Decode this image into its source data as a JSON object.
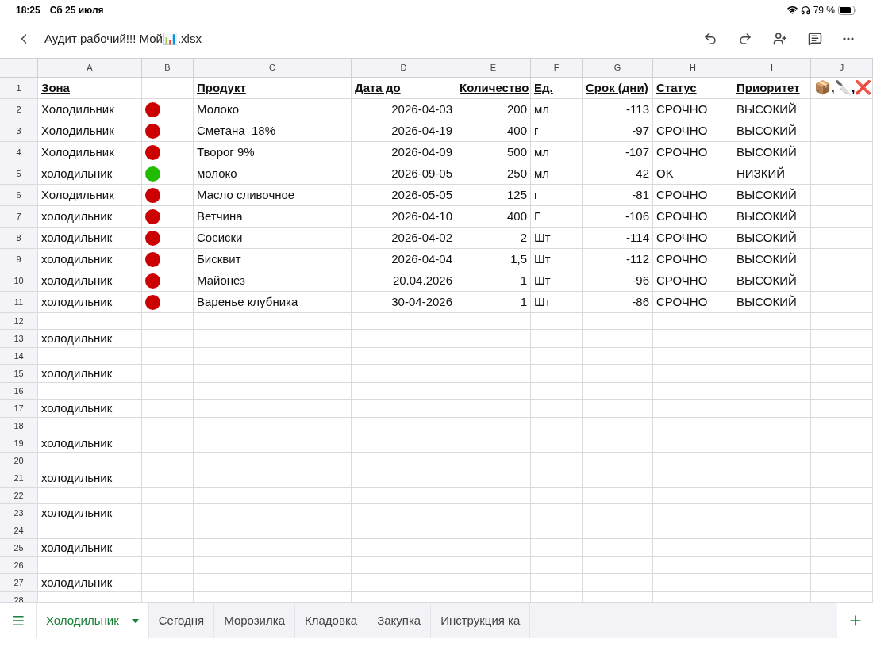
{
  "status_bar": {
    "time": "18:25",
    "date": "Сб 25 июля",
    "battery": "79 %"
  },
  "toolbar": {
    "title": "Аудит рабочий!!! Мой📊.xlsx"
  },
  "columns": [
    "A",
    "B",
    "C",
    "D",
    "E",
    "F",
    "G",
    "H",
    "I",
    "J"
  ],
  "rows": [
    {
      "number": "1",
      "kind": "header",
      "zone": "Зона",
      "product": "Продукт",
      "date": "Дата до",
      "qty": "Количество",
      "unit": "Ед.",
      "days": "Срок (дни)",
      "status": "Статус",
      "priority": "Приоритет",
      "extra": "📦,🔪,❌"
    },
    {
      "number": "2",
      "kind": "item",
      "zone": "Холодильник",
      "color": "#cc0000",
      "product": "Молоко",
      "date": "2026-04-03",
      "qty": "200",
      "unit": "мл",
      "days": "-113",
      "status": "СРОЧНО",
      "priority": "ВЫСОКИЙ"
    },
    {
      "number": "3",
      "kind": "item",
      "zone": "Холодильник",
      "color": "#cc0000",
      "product": "Сметана  18%",
      "date": "2026-04-19",
      "qty": "400",
      "unit": "г",
      "days": "-97",
      "status": "СРОЧНО",
      "priority": "ВЫСОКИЙ"
    },
    {
      "number": "4",
      "kind": "item",
      "zone": "Холодильник",
      "color": "#cc0000",
      "product": "Творог 9%",
      "date": "2026-04-09",
      "qty": "500",
      "unit": "мл",
      "days": "-107",
      "status": "СРОЧНО",
      "priority": "ВЫСОКИЙ"
    },
    {
      "number": "5",
      "kind": "item",
      "zone": "холодильник",
      "color": "#22bb00",
      "product": "молоко",
      "date": "2026-09-05",
      "qty": "250",
      "unit": "мл",
      "days": "42",
      "status": "OK",
      "priority": "НИЗКИЙ"
    },
    {
      "number": "6",
      "kind": "item",
      "zone": "Холодильник",
      "color": "#cc0000",
      "product": "Масло сливочное",
      "date": "2026-05-05",
      "qty": "125",
      "unit": "г",
      "days": "-81",
      "status": "СРОЧНО",
      "priority": "ВЫСОКИЙ"
    },
    {
      "number": "7",
      "kind": "item",
      "zone": "холодильник",
      "color": "#cc0000",
      "product": "Ветчина",
      "date": "2026-04-10",
      "qty": "400",
      "unit": "Г",
      "days": "-106",
      "status": "СРОЧНО",
      "priority": "ВЫСОКИЙ"
    },
    {
      "number": "8",
      "kind": "item",
      "zone": "холодильник",
      "color": "#cc0000",
      "product": "Сосиски",
      "date": "2026-04-02",
      "qty": "2",
      "unit": "Шт",
      "days": "-114",
      "status": "СРОЧНО",
      "priority": "ВЫСОКИЙ"
    },
    {
      "number": "9",
      "kind": "item",
      "zone": "холодильник",
      "color": "#cc0000",
      "product": "Бисквит",
      "date": "2026-04-04",
      "qty": "1,5",
      "unit": "Шт",
      "days": "-112",
      "status": "СРОЧНО",
      "priority": "ВЫСОКИЙ"
    },
    {
      "number": "10",
      "kind": "item",
      "zone": "холодильник",
      "color": "#cc0000",
      "product": "Майонез",
      "date": "20.04.2026",
      "qty": "1",
      "unit": "Шт",
      "days": "-96",
      "status": "СРОЧНО",
      "priority": "ВЫСОКИЙ"
    },
    {
      "number": "11",
      "kind": "item",
      "zone": "холодильник",
      "color": "#cc0000",
      "product": "Варенье клубника",
      "date": "30-04-2026",
      "qty": "1",
      "unit": "Шт",
      "days": "-86",
      "status": "СРОЧНО",
      "priority": "ВЫСОКИЙ"
    },
    {
      "number": "12",
      "kind": "blank"
    },
    {
      "number": "13",
      "kind": "zone",
      "zone": "холодильник"
    },
    {
      "number": "14",
      "kind": "blank"
    },
    {
      "number": "15",
      "kind": "zone",
      "zone": "холодильник"
    },
    {
      "number": "16",
      "kind": "blank"
    },
    {
      "number": "17",
      "kind": "zone",
      "zone": "холодильник"
    },
    {
      "number": "18",
      "kind": "blank"
    },
    {
      "number": "19",
      "kind": "zone",
      "zone": "холодильник"
    },
    {
      "number": "20",
      "kind": "blank"
    },
    {
      "number": "21",
      "kind": "zone",
      "zone": "холодильник"
    },
    {
      "number": "22",
      "kind": "blank"
    },
    {
      "number": "23",
      "kind": "zone",
      "zone": "холодильник"
    },
    {
      "number": "24",
      "kind": "blank"
    },
    {
      "number": "25",
      "kind": "zone",
      "zone": "холодильник"
    },
    {
      "number": "26",
      "kind": "blank"
    },
    {
      "number": "27",
      "kind": "zone",
      "zone": "холодильник"
    },
    {
      "number": "28",
      "kind": "blank"
    }
  ],
  "sheet_tabs": [
    {
      "label": "Холодильник",
      "selected": true
    },
    {
      "label": "Сегодня",
      "selected": false
    },
    {
      "label": "Морозилка",
      "selected": false
    },
    {
      "label": "Кладовка",
      "selected": false
    },
    {
      "label": "Закупка",
      "selected": false
    },
    {
      "label": "Инструкция ка",
      "selected": false
    }
  ]
}
